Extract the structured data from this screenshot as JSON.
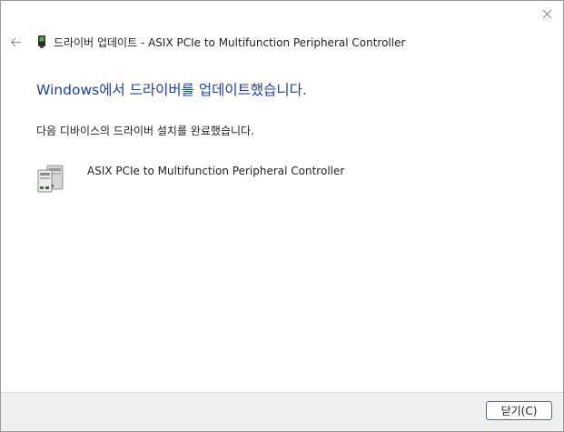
{
  "window": {
    "title": "드라이버 업데이트 - ASIX PCIe to Multifunction Peripheral Controller",
    "close_icon": "close-icon",
    "back_icon": "back-arrow-icon"
  },
  "main": {
    "heading": "Windows에서 드라이버를 업데이트했습니다.",
    "message": "다음 디바이스의 드라이버 설치를 완료했습니다.",
    "device": {
      "name": "ASIX PCIe to Multifunction Peripheral Controller",
      "icon": "device-icon"
    }
  },
  "footer": {
    "close_label": "닫기(C)"
  },
  "colors": {
    "heading": "#1b3fa3",
    "button_border": "#2a6fd6",
    "footer_bg": "#f0f0f0"
  }
}
